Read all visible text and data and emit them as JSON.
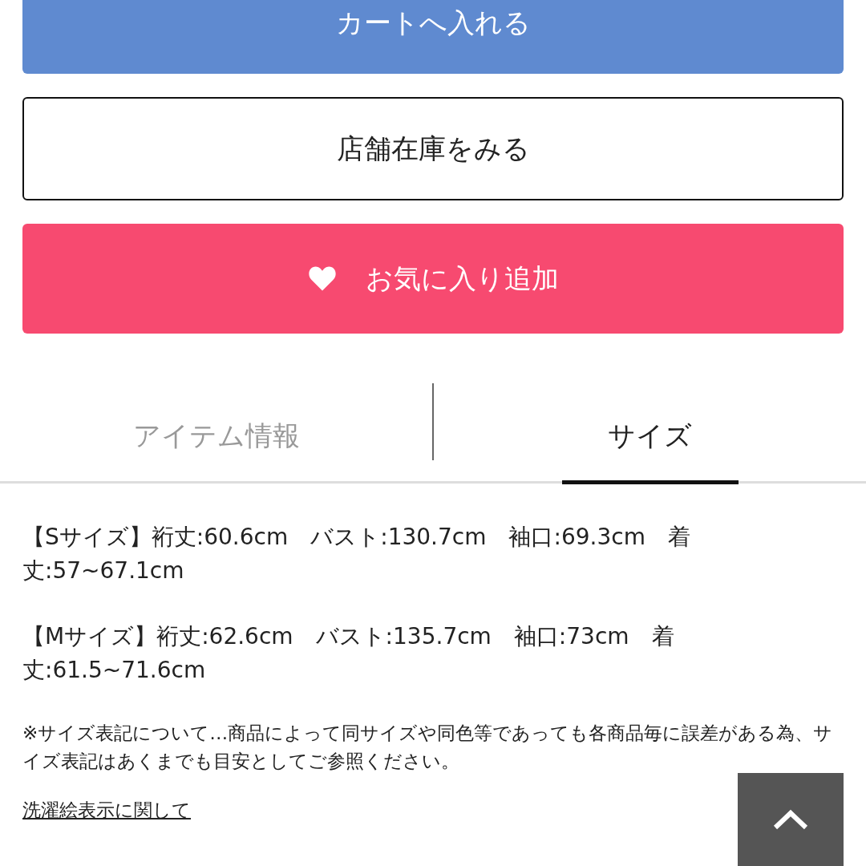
{
  "buttons": [
    {
      "kind": "cart",
      "label": "カートへ入れる"
    },
    {
      "kind": "store",
      "label": "店舗在庫をみる"
    },
    {
      "kind": "favorite",
      "label": "お気に入り追加"
    }
  ],
  "tabs": [
    {
      "label": "アイテム情報",
      "selected": false
    },
    {
      "label": "サイズ",
      "selected": true
    }
  ],
  "sizes": [
    "【Sサイズ】裄丈:60.6cm　バスト:130.7cm　袖口:69.3cm　着丈:57~67.1cm",
    "【Mサイズ】裄丈:62.6cm　バスト:135.7cm　袖口:73cm　着丈:61.5~71.6cm"
  ],
  "note": "※サイズ表記について…商品によって同サイズや同色等であっても各商品毎に誤差がある為、サイズ表記はあくまでも目安としてご参照ください。",
  "link": "洗濯絵表示に関して"
}
